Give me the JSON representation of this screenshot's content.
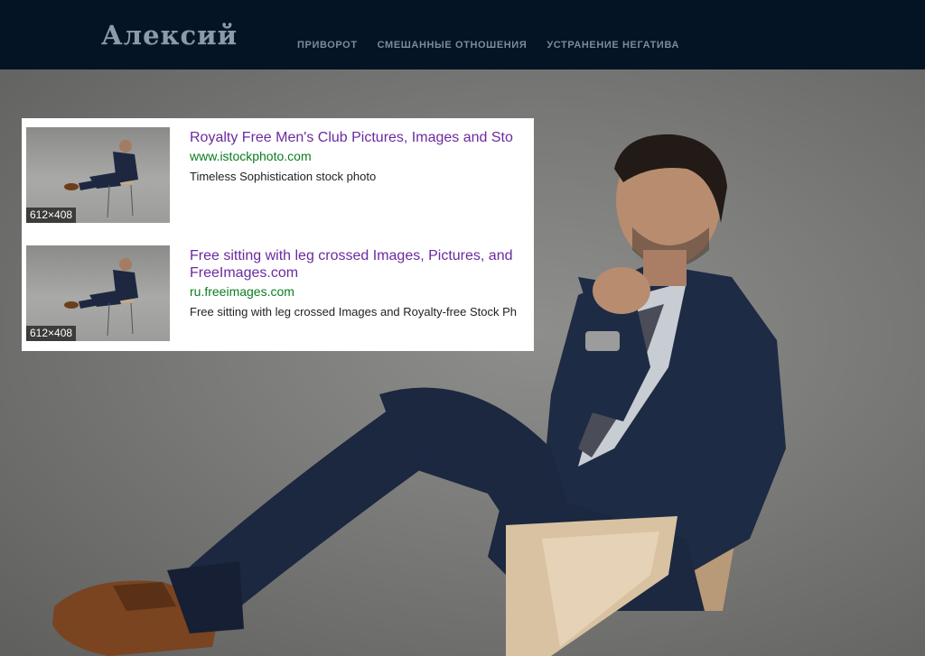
{
  "header": {
    "logo": "Алексий",
    "nav": [
      "ПРИВОРОТ",
      "СМЕШАННЫЕ ОТНОШЕНИЯ",
      "УСТРАНЕНИЕ НЕГАТИВА"
    ]
  },
  "colors": {
    "header_bg": "#041425",
    "result_title": "#6b2aa0",
    "result_url": "#0a7d20"
  },
  "search_results": [
    {
      "dimensions": "612×408",
      "title_line1": "Royalty Free Men's Club Pictures, Images and Sto",
      "title_line2": "",
      "url": "www.istockphoto.com",
      "description": "Timeless Sophistication stock photo"
    },
    {
      "dimensions": "612×408",
      "title_line1": "Free sitting with leg crossed Images, Pictures, and",
      "title_line2": "FreeImages.com",
      "url": "ru.freeimages.com",
      "description": "Free sitting with leg crossed Images and Royalty-free Stock Ph"
    }
  ]
}
